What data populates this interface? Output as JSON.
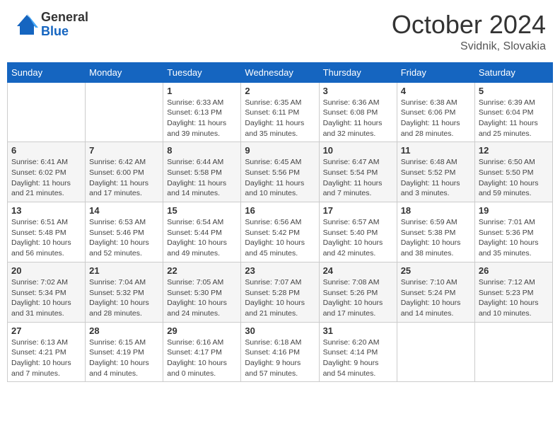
{
  "logo": {
    "general": "General",
    "blue": "Blue"
  },
  "title": "October 2024",
  "location": "Svidnik, Slovakia",
  "days_of_week": [
    "Sunday",
    "Monday",
    "Tuesday",
    "Wednesday",
    "Thursday",
    "Friday",
    "Saturday"
  ],
  "weeks": [
    [
      {
        "day": "",
        "info": ""
      },
      {
        "day": "",
        "info": ""
      },
      {
        "day": "1",
        "info": "Sunrise: 6:33 AM\nSunset: 6:13 PM\nDaylight: 11 hours and 39 minutes."
      },
      {
        "day": "2",
        "info": "Sunrise: 6:35 AM\nSunset: 6:11 PM\nDaylight: 11 hours and 35 minutes."
      },
      {
        "day": "3",
        "info": "Sunrise: 6:36 AM\nSunset: 6:08 PM\nDaylight: 11 hours and 32 minutes."
      },
      {
        "day": "4",
        "info": "Sunrise: 6:38 AM\nSunset: 6:06 PM\nDaylight: 11 hours and 28 minutes."
      },
      {
        "day": "5",
        "info": "Sunrise: 6:39 AM\nSunset: 6:04 PM\nDaylight: 11 hours and 25 minutes."
      }
    ],
    [
      {
        "day": "6",
        "info": "Sunrise: 6:41 AM\nSunset: 6:02 PM\nDaylight: 11 hours and 21 minutes."
      },
      {
        "day": "7",
        "info": "Sunrise: 6:42 AM\nSunset: 6:00 PM\nDaylight: 11 hours and 17 minutes."
      },
      {
        "day": "8",
        "info": "Sunrise: 6:44 AM\nSunset: 5:58 PM\nDaylight: 11 hours and 14 minutes."
      },
      {
        "day": "9",
        "info": "Sunrise: 6:45 AM\nSunset: 5:56 PM\nDaylight: 11 hours and 10 minutes."
      },
      {
        "day": "10",
        "info": "Sunrise: 6:47 AM\nSunset: 5:54 PM\nDaylight: 11 hours and 7 minutes."
      },
      {
        "day": "11",
        "info": "Sunrise: 6:48 AM\nSunset: 5:52 PM\nDaylight: 11 hours and 3 minutes."
      },
      {
        "day": "12",
        "info": "Sunrise: 6:50 AM\nSunset: 5:50 PM\nDaylight: 10 hours and 59 minutes."
      }
    ],
    [
      {
        "day": "13",
        "info": "Sunrise: 6:51 AM\nSunset: 5:48 PM\nDaylight: 10 hours and 56 minutes."
      },
      {
        "day": "14",
        "info": "Sunrise: 6:53 AM\nSunset: 5:46 PM\nDaylight: 10 hours and 52 minutes."
      },
      {
        "day": "15",
        "info": "Sunrise: 6:54 AM\nSunset: 5:44 PM\nDaylight: 10 hours and 49 minutes."
      },
      {
        "day": "16",
        "info": "Sunrise: 6:56 AM\nSunset: 5:42 PM\nDaylight: 10 hours and 45 minutes."
      },
      {
        "day": "17",
        "info": "Sunrise: 6:57 AM\nSunset: 5:40 PM\nDaylight: 10 hours and 42 minutes."
      },
      {
        "day": "18",
        "info": "Sunrise: 6:59 AM\nSunset: 5:38 PM\nDaylight: 10 hours and 38 minutes."
      },
      {
        "day": "19",
        "info": "Sunrise: 7:01 AM\nSunset: 5:36 PM\nDaylight: 10 hours and 35 minutes."
      }
    ],
    [
      {
        "day": "20",
        "info": "Sunrise: 7:02 AM\nSunset: 5:34 PM\nDaylight: 10 hours and 31 minutes."
      },
      {
        "day": "21",
        "info": "Sunrise: 7:04 AM\nSunset: 5:32 PM\nDaylight: 10 hours and 28 minutes."
      },
      {
        "day": "22",
        "info": "Sunrise: 7:05 AM\nSunset: 5:30 PM\nDaylight: 10 hours and 24 minutes."
      },
      {
        "day": "23",
        "info": "Sunrise: 7:07 AM\nSunset: 5:28 PM\nDaylight: 10 hours and 21 minutes."
      },
      {
        "day": "24",
        "info": "Sunrise: 7:08 AM\nSunset: 5:26 PM\nDaylight: 10 hours and 17 minutes."
      },
      {
        "day": "25",
        "info": "Sunrise: 7:10 AM\nSunset: 5:24 PM\nDaylight: 10 hours and 14 minutes."
      },
      {
        "day": "26",
        "info": "Sunrise: 7:12 AM\nSunset: 5:23 PM\nDaylight: 10 hours and 10 minutes."
      }
    ],
    [
      {
        "day": "27",
        "info": "Sunrise: 6:13 AM\nSunset: 4:21 PM\nDaylight: 10 hours and 7 minutes."
      },
      {
        "day": "28",
        "info": "Sunrise: 6:15 AM\nSunset: 4:19 PM\nDaylight: 10 hours and 4 minutes."
      },
      {
        "day": "29",
        "info": "Sunrise: 6:16 AM\nSunset: 4:17 PM\nDaylight: 10 hours and 0 minutes."
      },
      {
        "day": "30",
        "info": "Sunrise: 6:18 AM\nSunset: 4:16 PM\nDaylight: 9 hours and 57 minutes."
      },
      {
        "day": "31",
        "info": "Sunrise: 6:20 AM\nSunset: 4:14 PM\nDaylight: 9 hours and 54 minutes."
      },
      {
        "day": "",
        "info": ""
      },
      {
        "day": "",
        "info": ""
      }
    ]
  ]
}
